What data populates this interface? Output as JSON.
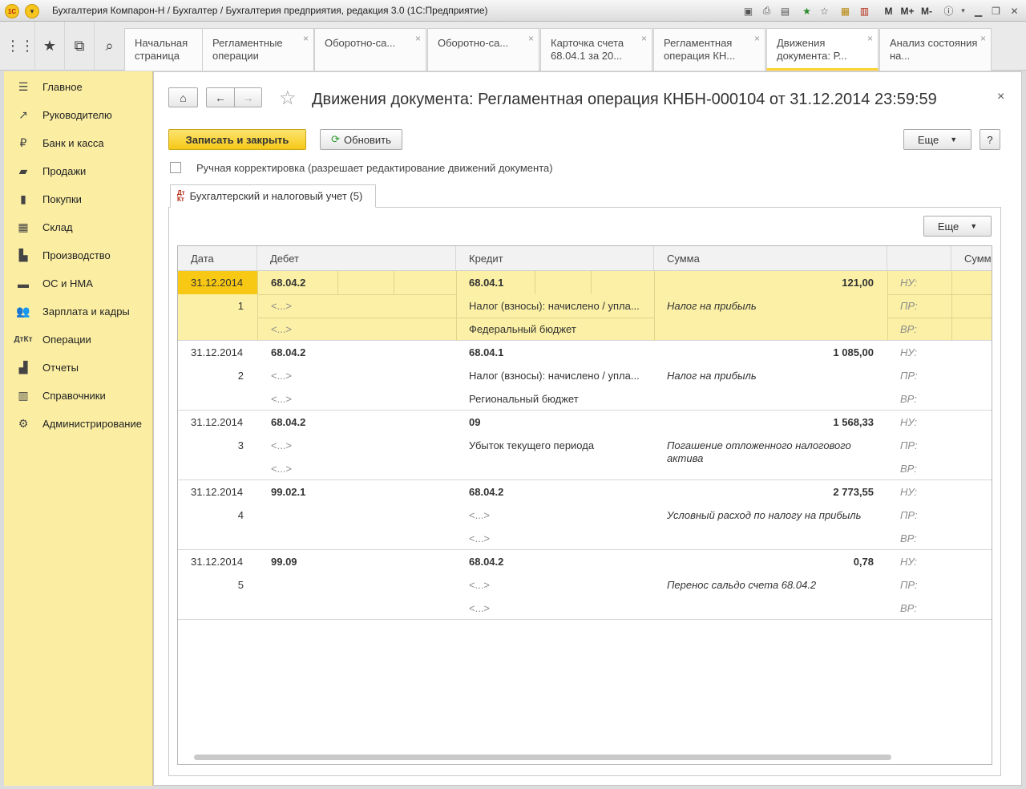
{
  "window": {
    "title": "Бухгалтерия Компарон-Н / Бухгалтер / Бухгалтерия предприятия, редакция 3.0  (1С:Предприятие)"
  },
  "tabs": [
    {
      "label": "Начальная страница",
      "closable": false
    },
    {
      "label": "Регламентные операции",
      "closable": true
    },
    {
      "label": "Оборотно-са...",
      "closable": true
    },
    {
      "label": "Оборотно-са...",
      "closable": true
    },
    {
      "label": "Карточка счета 68.04.1 за 20...",
      "closable": true
    },
    {
      "label": "Регламентная операция КН...",
      "closable": true
    },
    {
      "label": "Движения документа: Р...",
      "closable": true,
      "active": true
    },
    {
      "label": "Анализ состояния на...",
      "closable": true
    }
  ],
  "sidebar": {
    "items": [
      {
        "label": "Главное",
        "icon": "menu-icon"
      },
      {
        "label": "Руководителю",
        "icon": "trend-icon"
      },
      {
        "label": "Банк и касса",
        "icon": "ruble-icon"
      },
      {
        "label": "Продажи",
        "icon": "cart-icon"
      },
      {
        "label": "Покупки",
        "icon": "bag-icon"
      },
      {
        "label": "Склад",
        "icon": "warehouse-icon"
      },
      {
        "label": "Производство",
        "icon": "factory-icon"
      },
      {
        "label": "ОС и НМА",
        "icon": "truck-icon"
      },
      {
        "label": "Зарплата и кадры",
        "icon": "people-icon"
      },
      {
        "label": "Операции",
        "icon": "dt-kt-icon"
      },
      {
        "label": "Отчеты",
        "icon": "bar-chart-icon"
      },
      {
        "label": "Справочники",
        "icon": "book-icon"
      },
      {
        "label": "Администрирование",
        "icon": "gear-icon"
      }
    ]
  },
  "form": {
    "title": "Движения документа: Регламентная операция КНБН-000104 от 31.12.2014 23:59:59",
    "save_close_label": "Записать и закрыть",
    "refresh_label": "Обновить",
    "more_label": "Еще",
    "help_label": "?",
    "manual_checkbox_label": "Ручная корректировка (разрешает редактирование движений документа)",
    "manual_checked": false,
    "section_tab_label": "Бухгалтерский и налоговый учет (5)",
    "grid_more_label": "Еще"
  },
  "grid": {
    "headers": [
      "Дата",
      "Дебет",
      "Кредит",
      "Сумма",
      "",
      "Сумм"
    ],
    "rows": [
      {
        "date": "31.12.2014",
        "num": "1",
        "debit": "68.04.2",
        "debit_sub1": "<...>",
        "debit_sub2": "<...>",
        "credit": "68.04.1",
        "credit_sub1": "Налог (взносы): начислено / упла...",
        "credit_sub2": "Федеральный бюджет",
        "amount": "121,00",
        "content": "Налог на прибыль",
        "nu": "НУ:",
        "pr": "ПР:",
        "vr": "ВР:",
        "selected": true
      },
      {
        "date": "31.12.2014",
        "num": "2",
        "debit": "68.04.2",
        "debit_sub1": "<...>",
        "debit_sub2": "<...>",
        "credit": "68.04.1",
        "credit_sub1": "Налог (взносы): начислено / упла...",
        "credit_sub2": "Региональный бюджет",
        "amount": "1 085,00",
        "content": "Налог на прибыль",
        "nu": "НУ:",
        "pr": "ПР:",
        "vr": "ВР:"
      },
      {
        "date": "31.12.2014",
        "num": "3",
        "debit": "68.04.2",
        "debit_sub1": "<...>",
        "debit_sub2": "<...>",
        "credit": "09",
        "credit_sub1": "Убыток текущего периода",
        "credit_sub2": "",
        "amount": "1 568,33",
        "content": "Погашение отложенного налогового актива",
        "nu": "НУ:",
        "pr": "ПР:",
        "vr": "ВР:"
      },
      {
        "date": "31.12.2014",
        "num": "4",
        "debit": "99.02.1",
        "debit_sub1": "",
        "debit_sub2": "",
        "credit": "68.04.2",
        "credit_sub1": "<...>",
        "credit_sub2": "<...>",
        "amount": "2 773,55",
        "content": "Условный расход по налогу на прибыль",
        "nu": "НУ:",
        "pr": "ПР:",
        "vr": "ВР:"
      },
      {
        "date": "31.12.2014",
        "num": "5",
        "debit": "99.09",
        "debit_sub1": "",
        "debit_sub2": "",
        "credit": "68.04.2",
        "credit_sub1": "<...>",
        "credit_sub2": "<...>",
        "amount": "0,78",
        "content": "Перенос сальдо счета 68.04.2",
        "nu": "НУ:",
        "pr": "ПР:",
        "vr": "ВР:"
      }
    ]
  },
  "colors": {
    "sidebar_bg": "#fbeea3",
    "selected_row": "#fbf0a5",
    "selected_cell": "#f7c814",
    "accent_yellow": "#f5c817"
  }
}
